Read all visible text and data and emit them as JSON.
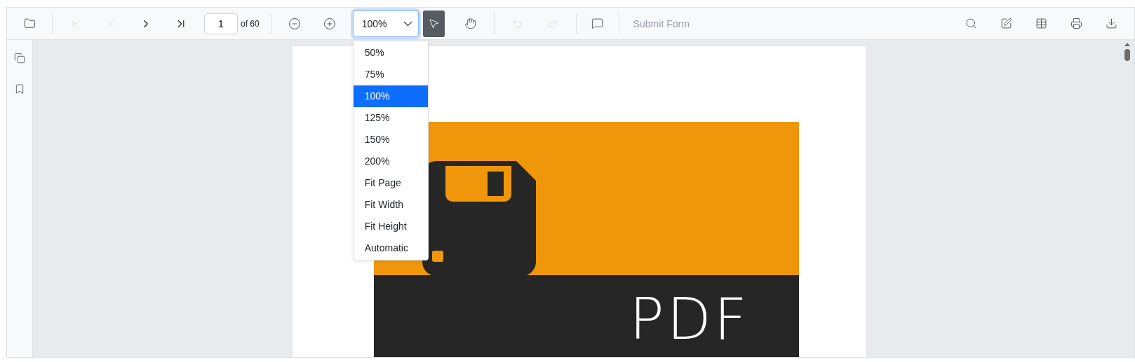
{
  "toolbar": {
    "navigation": [
      {
        "disabled": true
      },
      {
        "disabled": true
      },
      {
        "disabled": false
      },
      {
        "disabled": false
      }
    ],
    "page_input": {
      "value": "1"
    },
    "page_count": "of 60",
    "zoom_buttons": [
      {
        "disabled": false
      },
      {
        "disabled": false
      }
    ],
    "zoom": {
      "value": "100%",
      "expanded": true
    },
    "modes": [
      {
        "selected": true
      },
      {
        "selected": false
      }
    ],
    "history": [
      {
        "disabled": true
      },
      {
        "disabled": true
      }
    ],
    "submit_form": {
      "label": "Submit Form",
      "disabled": true
    }
  },
  "zoom_menu": [
    {
      "label": "50%",
      "selected": false
    },
    {
      "label": "75%",
      "selected": false
    },
    {
      "label": "100%",
      "selected": true
    },
    {
      "label": "125%",
      "selected": false
    },
    {
      "label": "150%",
      "selected": false
    },
    {
      "label": "200%",
      "selected": false
    },
    {
      "label": "Fit Page",
      "selected": false
    },
    {
      "label": "Fit Width",
      "selected": false
    },
    {
      "label": "Fit Height",
      "selected": false
    },
    {
      "label": "Automatic",
      "selected": false
    }
  ],
  "document": {
    "page_text": "PDF"
  }
}
